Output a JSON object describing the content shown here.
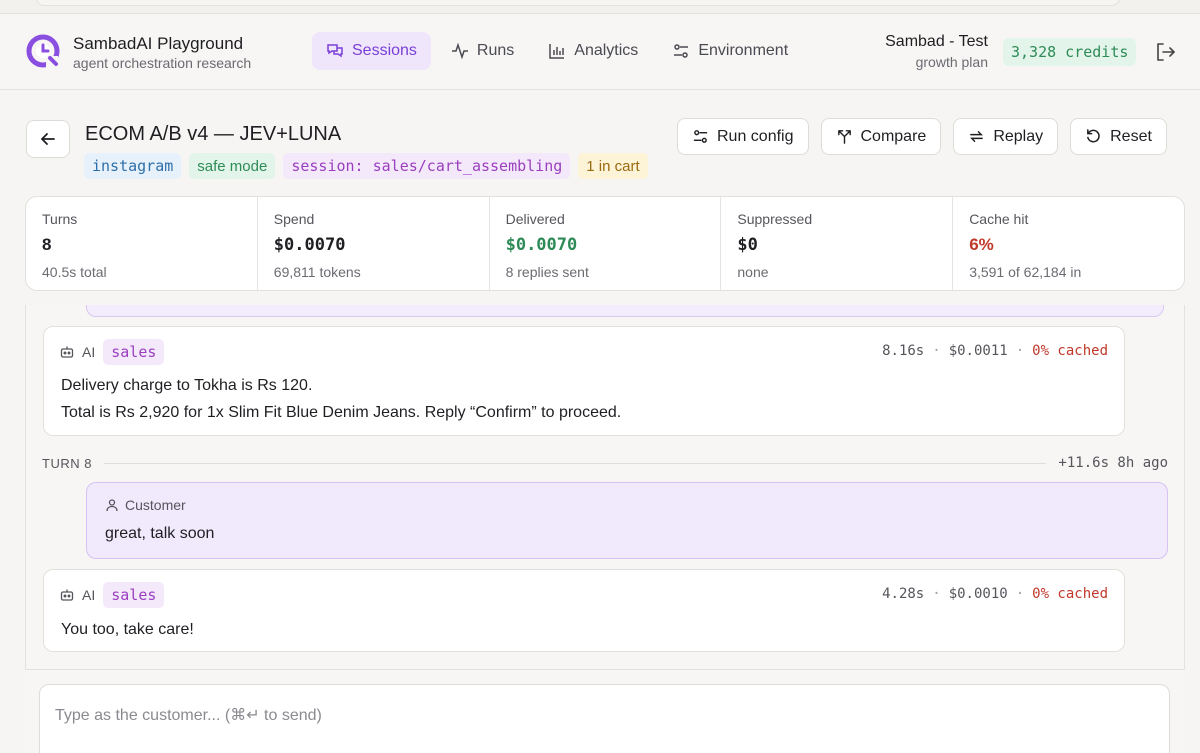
{
  "header": {
    "brand_title": "SambadAI Playground",
    "brand_sub": "agent orchestration research",
    "nav": [
      {
        "label": "Sessions",
        "icon": "chat-icon",
        "active": true
      },
      {
        "label": "Runs",
        "icon": "pulse-icon"
      },
      {
        "label": "Analytics",
        "icon": "bar-chart-icon"
      },
      {
        "label": "Environment",
        "icon": "sliders-icon"
      }
    ],
    "account_name": "Sambad - Test",
    "account_plan": "growth plan",
    "credits": "3,328 credits"
  },
  "session": {
    "title": "ECOM A/B v4 — JEV+LUNA",
    "tags": [
      "instagram",
      "safe mode",
      "session: sales/cart_assembling",
      "1 in cart"
    ],
    "actions": [
      "Run config",
      "Compare",
      "Replay",
      "Reset"
    ]
  },
  "stats": [
    {
      "label": "Turns",
      "value": "8",
      "sub": "40.5s total"
    },
    {
      "label": "Spend",
      "value": "$0.0070",
      "sub": "69,811 tokens"
    },
    {
      "label": "Delivered",
      "value": "$0.0070",
      "sub": "8 replies sent"
    },
    {
      "label": "Suppressed",
      "value": "$0",
      "sub": "none"
    },
    {
      "label": "Cache hit",
      "value": "6%",
      "sub": "3,591 of 62,184 in"
    }
  ],
  "colors": {
    "accent_purple": "#7a3fd6",
    "success_green": "#2e8b57",
    "danger_red": "#c0392b"
  },
  "transcript": {
    "msg1": {
      "sender": "AI",
      "role": "sales",
      "time": "8.16s",
      "cost": "$0.0011",
      "cached": "0% cached",
      "line1": "Delivery charge to Tokha is Rs 120.",
      "line2": "Total is Rs 2,920 for 1x Slim Fit Blue Denim Jeans. Reply “Confirm” to proceed."
    },
    "turn": {
      "label": "TURN 8",
      "time": "+11.6s 8h ago"
    },
    "customer": {
      "sender": "Customer",
      "text": "great, talk soon"
    },
    "msg2": {
      "sender": "AI",
      "role": "sales",
      "time": "4.28s",
      "cost": "$0.0010",
      "cached": "0% cached",
      "line1": "You too, take care!"
    }
  },
  "composer": {
    "placeholder": "Type as the customer... (⌘↵ to send)"
  }
}
